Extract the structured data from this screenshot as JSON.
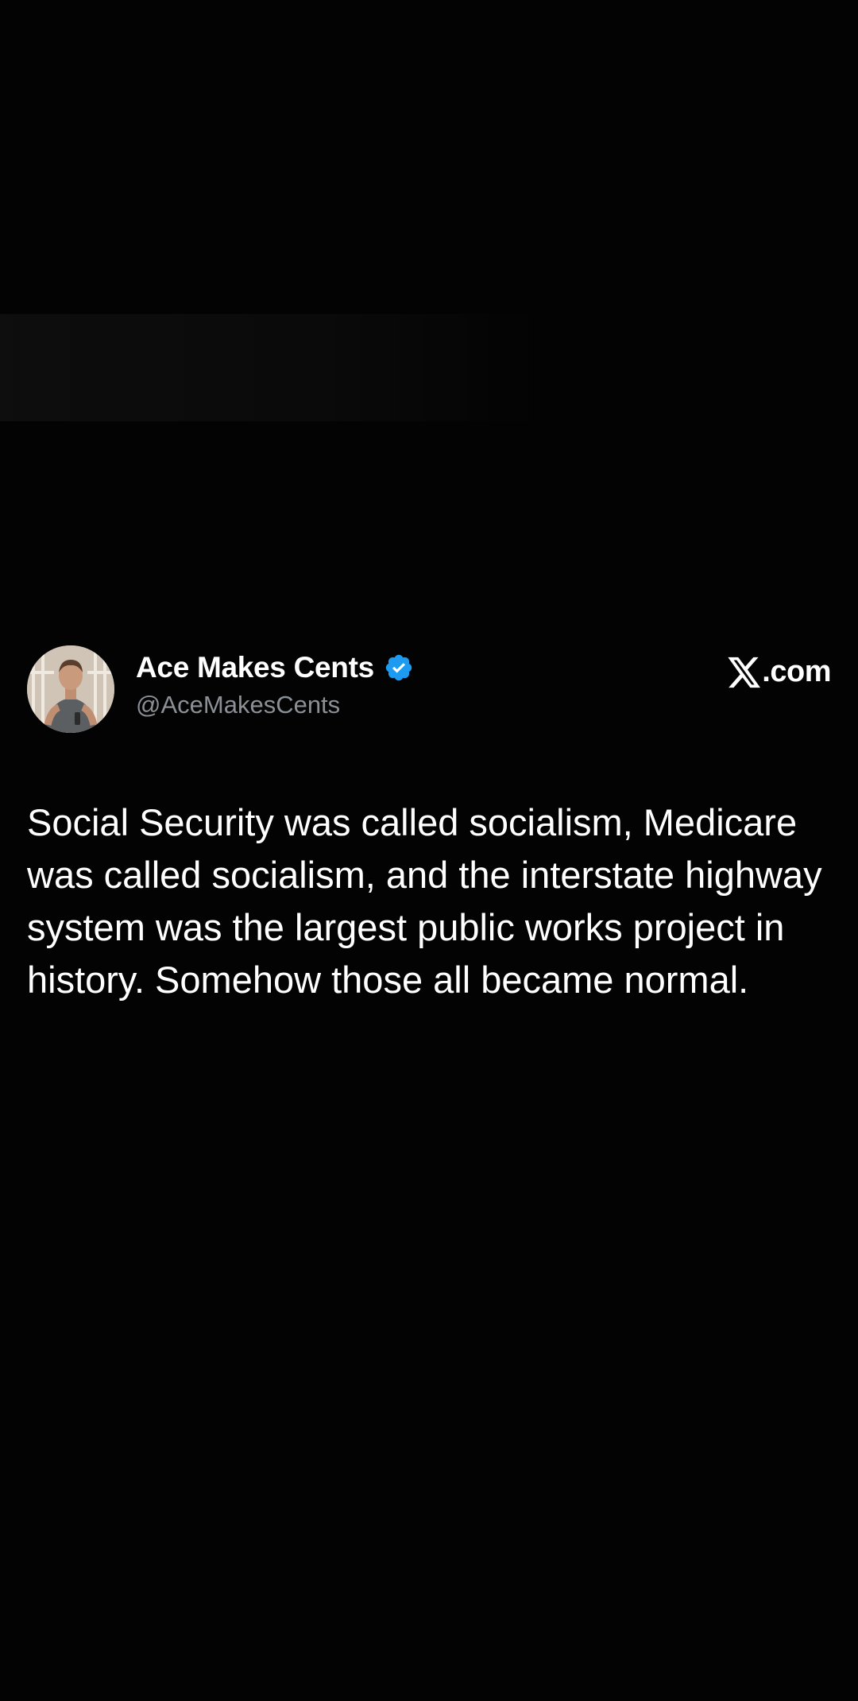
{
  "tweet": {
    "display_name": "Ace Makes Cents",
    "handle": "@AceMakesCents",
    "verified": true,
    "source_label": ".com",
    "text": "Social Security was called socialism, Medicare was called socialism, and the interstate highway system was the largest public works project in history. Somehow those all became normal."
  },
  "icons": {
    "verified": "verified-badge-icon",
    "brand": "x-logo-icon",
    "avatar": "user-avatar"
  },
  "colors": {
    "background": "#030303",
    "text": "#ffffff",
    "handle": "#8b9096",
    "verified": "#1d9bf0"
  }
}
